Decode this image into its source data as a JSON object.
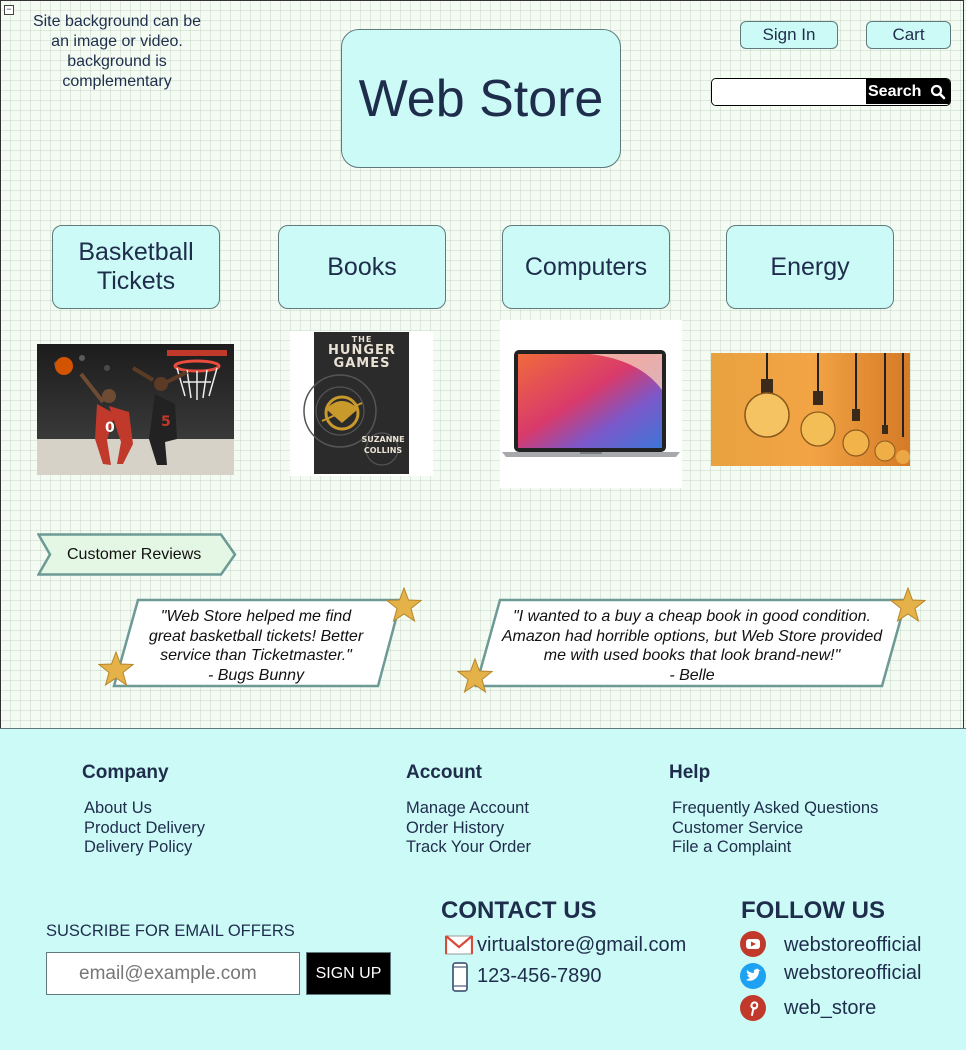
{
  "note": {
    "line1": "Site background can be",
    "line2": "an image or video.",
    "line3": "background is",
    "line4": "complementary"
  },
  "header": {
    "title": "Web Store",
    "sign_in_label": "Sign In",
    "cart_label": "Cart",
    "search_label": "Search"
  },
  "categories": [
    {
      "line1": "Basketball",
      "line2": "Tickets"
    },
    {
      "label": "Books"
    },
    {
      "label": "Computers"
    },
    {
      "label": "Energy"
    }
  ],
  "book_cover": {
    "line1": "THE",
    "line2": "HUNGER",
    "line3": "GAMES",
    "author1": "SUZANNE",
    "author2": "COLLINS"
  },
  "reviews": {
    "heading": "Customer Reviews",
    "items": [
      {
        "lines": [
          "\"Web Store helped me find",
          "great basketball tickets! Better",
          "service than Ticketmaster.\"",
          "- Bugs Bunny"
        ]
      },
      {
        "lines": [
          "\"I wanted to a buy a cheap book in good condition.",
          "Amazon had horrible options, but Web Store provided",
          "me with used books that look brand-new!\"",
          "- Belle"
        ]
      }
    ]
  },
  "footer": {
    "company": {
      "heading": "Company",
      "links": [
        "About Us",
        "Product Delivery",
        "Delivery Policy"
      ]
    },
    "account": {
      "heading": "Account",
      "links": [
        "Manage Account",
        "Order History",
        "Track Your Order"
      ]
    },
    "help": {
      "heading": "Help",
      "links": [
        "Frequently Asked Questions",
        "Customer Service",
        "File a Complaint"
      ]
    },
    "subscribe": {
      "label": "SUSCRIBE FOR EMAIL OFFERS",
      "placeholder": "email@example.com",
      "button": "SIGN UP"
    },
    "contact": {
      "heading": "CONTACT US",
      "email": "virtualstore@gmail.com",
      "phone": "123-456-7890"
    },
    "follow": {
      "heading": "FOLLOW US",
      "youtube": "webstoreofficial",
      "twitter": "webstoreofficial",
      "pinterest": "web_store"
    }
  },
  "colors": {
    "accent_box": "#ccfaf6",
    "border": "#5f7a7c",
    "text": "#1f2d4d",
    "social_icon": "#c0392b",
    "twitter_icon": "#1da1f2"
  }
}
